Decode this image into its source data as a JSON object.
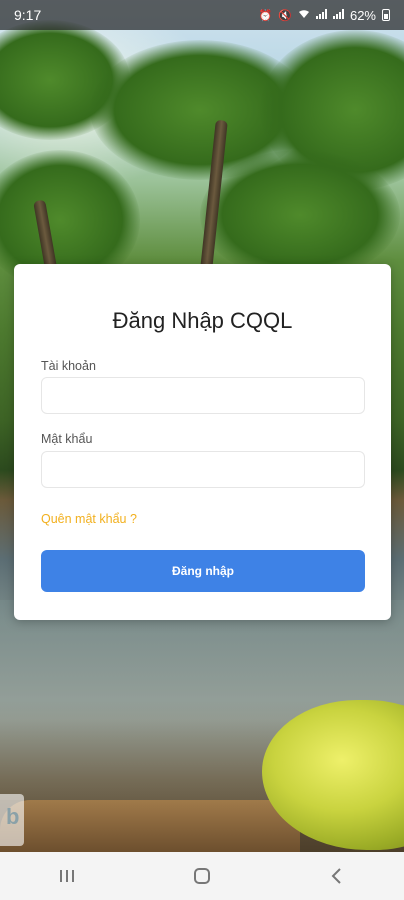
{
  "status_bar": {
    "time": "9:17",
    "battery_percent": "62%",
    "icons": [
      "alarm-icon",
      "mute-icon",
      "wifi-icon",
      "signal-icon",
      "signal-icon",
      "battery-icon"
    ]
  },
  "login": {
    "title": "Đăng Nhập CQQL",
    "account_label": "Tài khoản",
    "account_value": "",
    "password_label": "Mật khẩu",
    "password_value": "",
    "forgot_link": "Quên mật khẩu ?",
    "submit_label": "Đăng nhập"
  },
  "colors": {
    "primary_button": "#3e82e6",
    "link": "#f2b01e",
    "card_bg": "#ffffff"
  },
  "navigation_bar": {
    "buttons": [
      "recent-apps-icon",
      "home-icon",
      "back-icon"
    ]
  }
}
